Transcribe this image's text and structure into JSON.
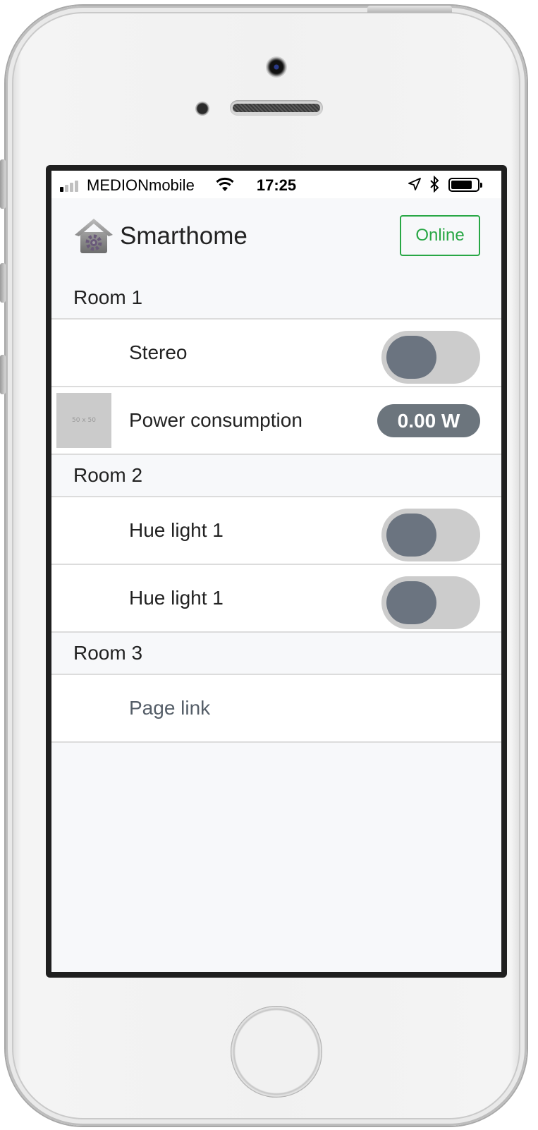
{
  "status_bar": {
    "carrier": "MEDIONmobile",
    "time": "17:25",
    "battery_level": 0.8
  },
  "header": {
    "title": "Smarthome",
    "connection_status": "Online",
    "connection_color": "#28a745"
  },
  "rooms": [
    {
      "name": "Room 1",
      "items": [
        {
          "label": "Stereo",
          "type": "toggle",
          "on": false
        },
        {
          "label": "Power consumption",
          "type": "value",
          "value": "0.00 W",
          "thumbnail": "50 x 50"
        }
      ]
    },
    {
      "name": "Room 2",
      "items": [
        {
          "label": "Hue light 1",
          "type": "toggle",
          "on": false
        },
        {
          "label": "Hue light 1",
          "type": "toggle",
          "on": false
        }
      ]
    },
    {
      "name": "Room 3",
      "items": [
        {
          "label": "Page link",
          "type": "link"
        }
      ]
    }
  ],
  "icons": {
    "app": "house-gear-icon",
    "signal": "signal-strength-icon",
    "wifi": "wifi-icon",
    "location": "location-arrow-icon",
    "bluetooth": "bluetooth-icon",
    "battery": "battery-icon"
  }
}
